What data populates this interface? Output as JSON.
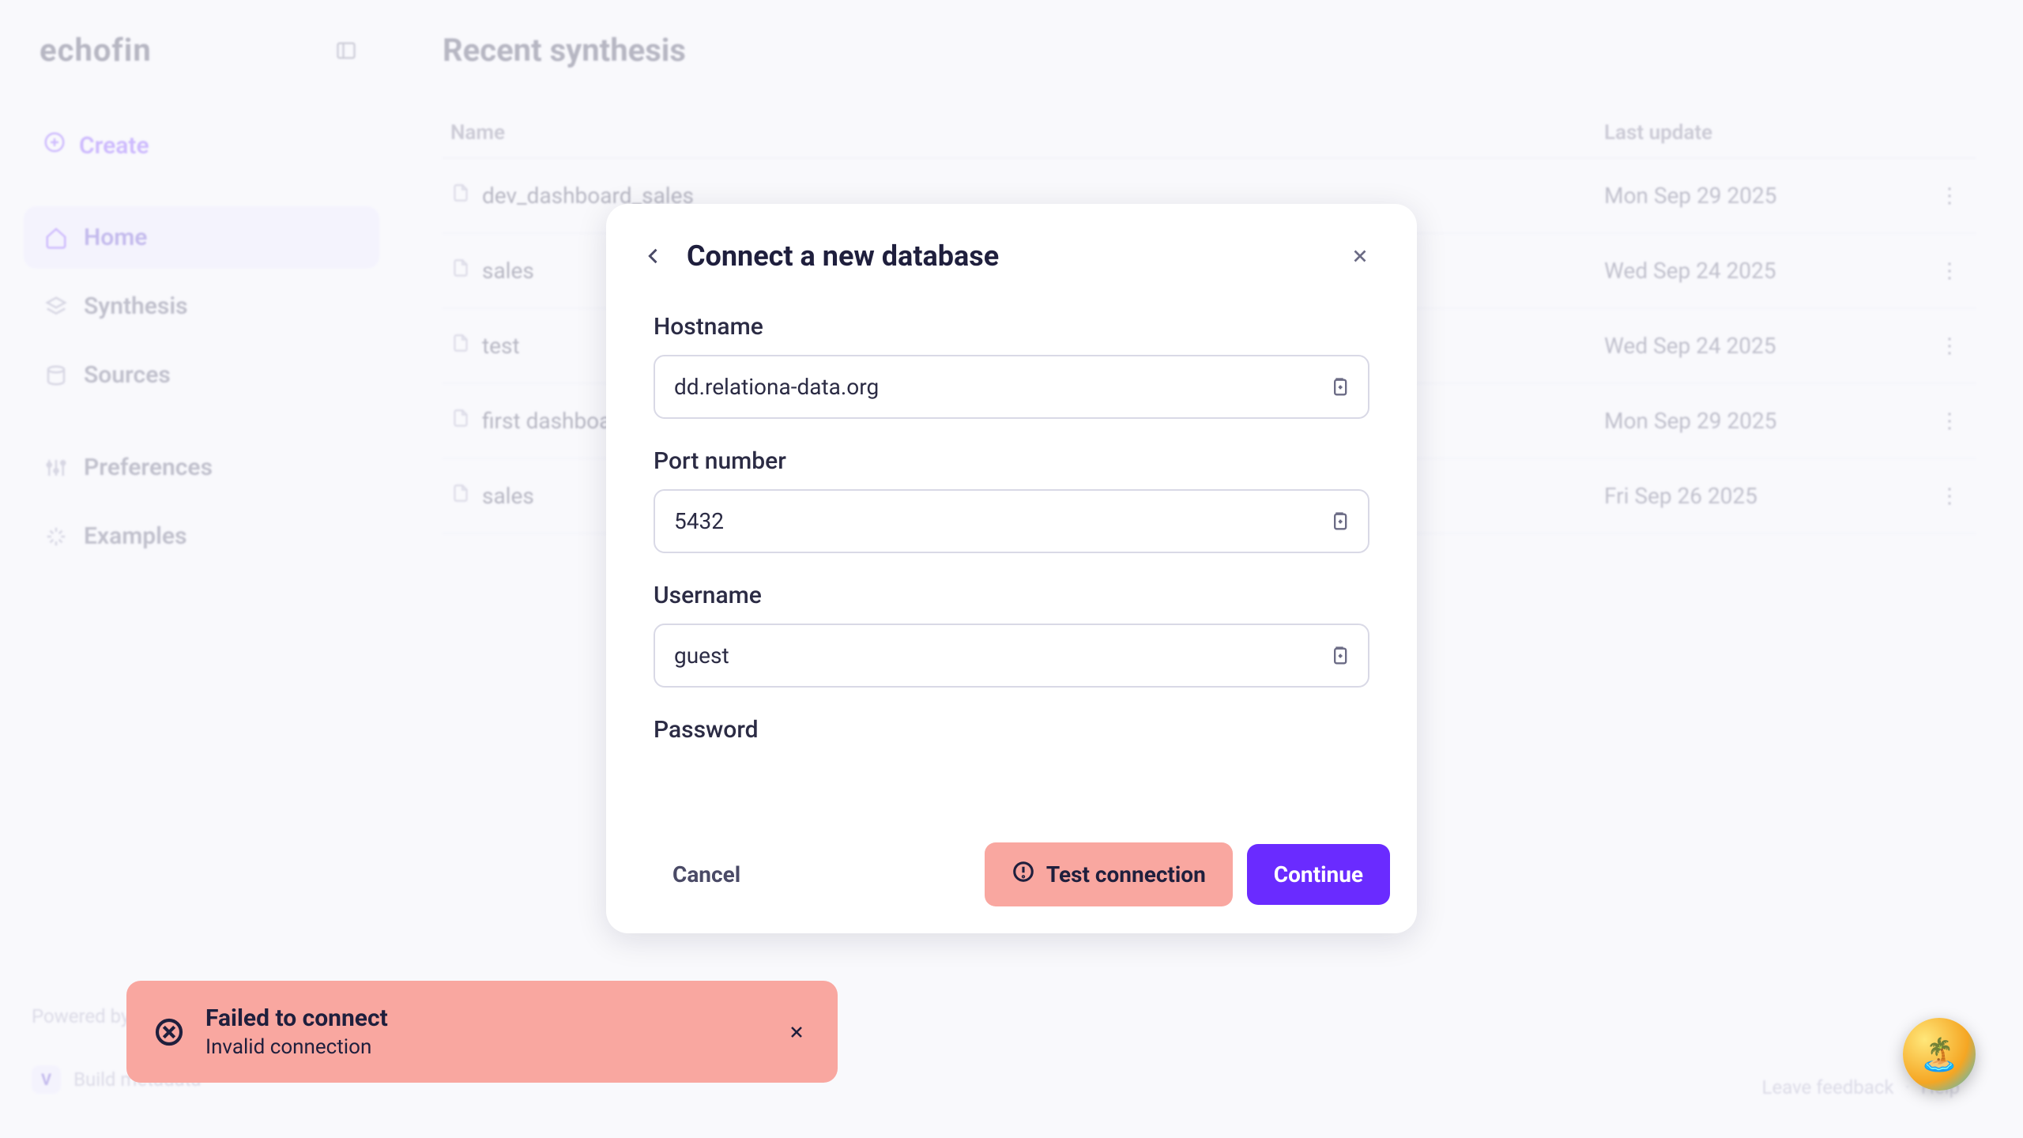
{
  "brand": "echofin",
  "create_label": "Create",
  "sidebar": {
    "items": [
      {
        "label": "Home",
        "icon": "home-icon"
      },
      {
        "label": "Synthesis",
        "icon": "stack-icon"
      },
      {
        "label": "Sources",
        "icon": "database-icon"
      }
    ],
    "secondary": [
      {
        "label": "Preferences",
        "icon": "sliders-icon"
      },
      {
        "label": "Examples",
        "icon": "sparkle-icon"
      }
    ],
    "legal": "Powered by echofin",
    "version_badge": "V",
    "version_text": "Build metadata"
  },
  "page": {
    "title": "Recent synthesis",
    "columns": {
      "name": "Name",
      "updated": "Last update"
    },
    "rows": [
      {
        "name": "dev_dashboard_sales",
        "date": "Mon Sep 29 2025"
      },
      {
        "name": "sales",
        "date": "Wed Sep 24 2025"
      },
      {
        "name": "test",
        "date": "Wed Sep 24 2025"
      },
      {
        "name": "first dashboard",
        "date": "Mon Sep 29 2025"
      },
      {
        "name": "sales",
        "date": "Fri Sep 26 2025"
      }
    ],
    "footer": {
      "feedback": "Leave feedback",
      "help": "Help"
    }
  },
  "modal": {
    "title": "Connect a new database",
    "fields": {
      "hostname": {
        "label": "Hostname",
        "value": "dd.relationa-data.org"
      },
      "port": {
        "label": "Port number",
        "value": "5432"
      },
      "username": {
        "label": "Username",
        "value": "guest"
      },
      "password": {
        "label": "Password",
        "value": ""
      }
    },
    "buttons": {
      "cancel": "Cancel",
      "test": "Test connection",
      "continue": "Continue"
    }
  },
  "toast": {
    "title": "Failed to connect",
    "subtitle": "Invalid connection"
  }
}
